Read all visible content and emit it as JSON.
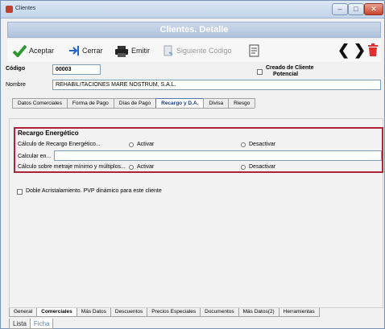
{
  "window": {
    "title": "Clientes",
    "min_glyph": "–",
    "max_glyph": "□",
    "close_glyph": "✕"
  },
  "banner": {
    "title": "Clientes. Detalle"
  },
  "toolbar": {
    "aceptar": "Aceptar",
    "cerrar": "Cerrar",
    "emitir": "Emitir",
    "siguiente": "Siguiente Código",
    "prev_glyph": "❮",
    "next_glyph": "❯"
  },
  "header": {
    "codigo_label": "Código",
    "codigo_value": "00003",
    "potencial_label_1": "Creado de Cliente",
    "potencial_label_2": "Potencial",
    "nombre_label": "Nombre",
    "nombre_value": "REHABILITACIONES MARE NOSTRUM, S.A.L."
  },
  "tabs": [
    "Datos Comerciales",
    "Forma de Pago",
    "Días de Pago",
    "Recargo y D.A.",
    "Divisa",
    "Riesgo"
  ],
  "active_tab": 3,
  "recargo": {
    "title": "Recargo Energético",
    "calculo_label": "Cálculo de Recargo Energético...",
    "activar": "Activar",
    "desactivar": "Desactivar",
    "calcular_label": "Calcular en...",
    "calcular_value": "",
    "metraje_label": "Cálculo sobre metraje mínimo y múltiplos...",
    "activar2": "Activar",
    "desactivar2": "Desactivar"
  },
  "doble": {
    "label": "Doble Acristalamiento. PVP dinámico para este cliente"
  },
  "bottom_tabs": [
    "General",
    "Comerciales",
    "Más Datos",
    "Descuentos",
    "Precios Especiales",
    "Documentos",
    "Más Datos(2)",
    "Herramientas"
  ],
  "active_bottom_tab": 1,
  "view_tabs": [
    "Lista",
    "Ficha"
  ],
  "active_view_tab": 1,
  "colors": {
    "accent": "#b0213a",
    "banner": "#afc2dc"
  }
}
